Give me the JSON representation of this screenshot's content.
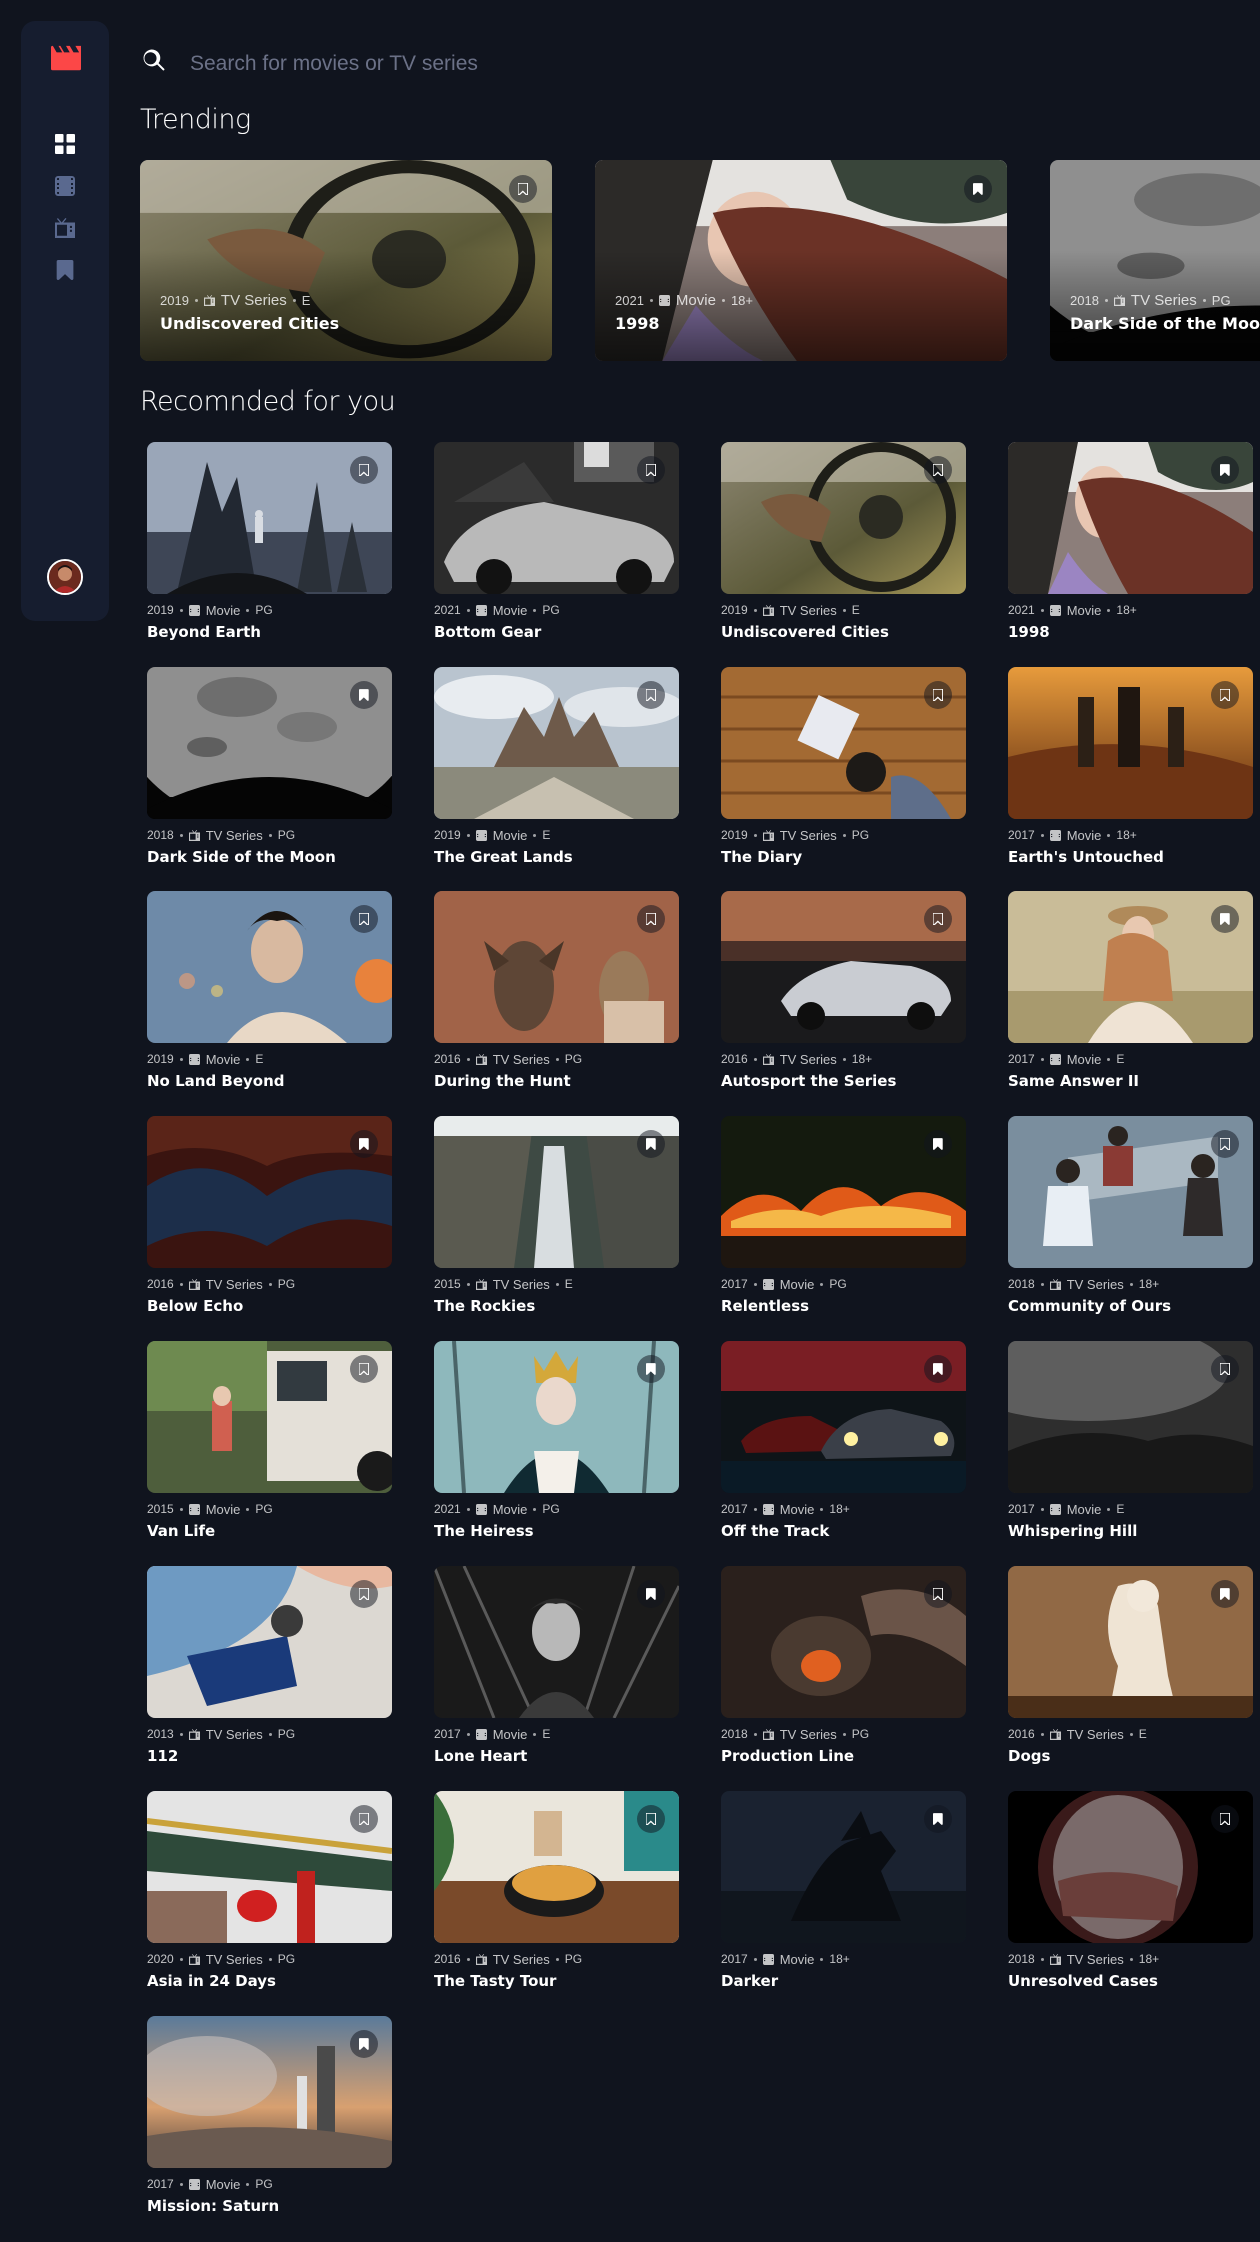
{
  "search": {
    "placeholder": "Search for movies or TV series"
  },
  "sections": {
    "trending": "Trending",
    "recommended": "Recomnded for you"
  },
  "nav": [
    "home",
    "movies",
    "tv-series",
    "bookmarks"
  ],
  "colors": {
    "accent": "#fc4747",
    "background": "#10141e",
    "sidebar": "#161d2f",
    "nav_inactive": "#5a698f"
  },
  "trending": [
    {
      "year": "2019",
      "category": "TV Series",
      "rating": "E",
      "title": "Undiscovered Cities",
      "bookmarked": false,
      "thumb": "car"
    },
    {
      "year": "2021",
      "category": "Movie",
      "rating": "18+",
      "title": "1998",
      "bookmarked": true,
      "thumb": "girl"
    },
    {
      "year": "2018",
      "category": "TV Series",
      "rating": "PG",
      "title": "Dark Side of the Moon",
      "bookmarked": true,
      "thumb": "moon"
    }
  ],
  "recommended": [
    {
      "year": "2019",
      "category": "Movie",
      "rating": "PG",
      "title": "Beyond Earth",
      "bookmarked": false,
      "thumb": "earth"
    },
    {
      "year": "2021",
      "category": "Movie",
      "rating": "PG",
      "title": "Bottom Gear",
      "bookmarked": false,
      "thumb": "garage"
    },
    {
      "year": "2019",
      "category": "TV Series",
      "rating": "E",
      "title": "Undiscovered Cities",
      "bookmarked": false,
      "thumb": "car"
    },
    {
      "year": "2021",
      "category": "Movie",
      "rating": "18+",
      "title": "1998",
      "bookmarked": true,
      "thumb": "girl"
    },
    {
      "year": "2018",
      "category": "TV Series",
      "rating": "PG",
      "title": "Dark Side of the Moon",
      "bookmarked": true,
      "thumb": "moon"
    },
    {
      "year": "2019",
      "category": "Movie",
      "rating": "E",
      "title": "The Great Lands",
      "bookmarked": false,
      "thumb": "lands"
    },
    {
      "year": "2019",
      "category": "TV Series",
      "rating": "PG",
      "title": "The Diary",
      "bookmarked": false,
      "thumb": "diary"
    },
    {
      "year": "2017",
      "category": "Movie",
      "rating": "18+",
      "title": "Earth's Untouched",
      "bookmarked": false,
      "thumb": "sunset"
    },
    {
      "year": "2019",
      "category": "Movie",
      "rating": "E",
      "title": "No Land Beyond",
      "bookmarked": false,
      "thumb": "boy"
    },
    {
      "year": "2016",
      "category": "TV Series",
      "rating": "PG",
      "title": "During the Hunt",
      "bookmarked": false,
      "thumb": "deer"
    },
    {
      "year": "2016",
      "category": "TV Series",
      "rating": "18+",
      "title": "Autosport the Series",
      "bookmarked": false,
      "thumb": "bmw"
    },
    {
      "year": "2017",
      "category": "Movie",
      "rating": "E",
      "title": "Same Answer II",
      "bookmarked": true,
      "thumb": "woman"
    },
    {
      "year": "2016",
      "category": "TV Series",
      "rating": "PG",
      "title": "Below Echo",
      "bookmarked": true,
      "thumb": "cave"
    },
    {
      "year": "2015",
      "category": "TV Series",
      "rating": "E",
      "title": "The Rockies",
      "bookmarked": true,
      "thumb": "falls"
    },
    {
      "year": "2017",
      "category": "Movie",
      "rating": "PG",
      "title": "Relentless",
      "bookmarked": true,
      "thumb": "fire"
    },
    {
      "year": "2018",
      "category": "TV Series",
      "rating": "18+",
      "title": "Community of Ours",
      "bookmarked": false,
      "thumb": "people"
    },
    {
      "year": "2015",
      "category": "Movie",
      "rating": "PG",
      "title": "Van Life",
      "bookmarked": false,
      "thumb": "van"
    },
    {
      "year": "2021",
      "category": "Movie",
      "rating": "PG",
      "title": "The Heiress",
      "bookmarked": true,
      "thumb": "heiress"
    },
    {
      "year": "2017",
      "category": "Movie",
      "rating": "18+",
      "title": "Off the Track",
      "bookmarked": true,
      "thumb": "track"
    },
    {
      "year": "2017",
      "category": "Movie",
      "rating": "E",
      "title": "Whispering Hill",
      "bookmarked": false,
      "thumb": "hill"
    },
    {
      "year": "2013",
      "category": "TV Series",
      "rating": "PG",
      "title": "112",
      "bookmarked": false,
      "thumb": "medical"
    },
    {
      "year": "2017",
      "category": "Movie",
      "rating": "E",
      "title": "Lone Heart",
      "bookmarked": true,
      "thumb": "lone"
    },
    {
      "year": "2018",
      "category": "TV Series",
      "rating": "PG",
      "title": "Production Line",
      "bookmarked": false,
      "thumb": "production"
    },
    {
      "year": "2016",
      "category": "TV Series",
      "rating": "E",
      "title": "Dogs",
      "bookmarked": true,
      "thumb": "dog"
    },
    {
      "year": "2020",
      "category": "TV Series",
      "rating": "PG",
      "title": "Asia in 24 Days",
      "bookmarked": false,
      "thumb": "asia"
    },
    {
      "year": "2016",
      "category": "TV Series",
      "rating": "PG",
      "title": "The Tasty Tour",
      "bookmarked": false,
      "thumb": "food"
    },
    {
      "year": "2017",
      "category": "Movie",
      "rating": "18+",
      "title": "Darker",
      "bookmarked": true,
      "thumb": "darker"
    },
    {
      "year": "2018",
      "category": "TV Series",
      "rating": "18+",
      "title": "Unresolved Cases",
      "bookmarked": false,
      "thumb": "cases"
    },
    {
      "year": "2017",
      "category": "Movie",
      "rating": "PG",
      "title": "Mission: Saturn",
      "bookmarked": true,
      "thumb": "rocket"
    }
  ]
}
